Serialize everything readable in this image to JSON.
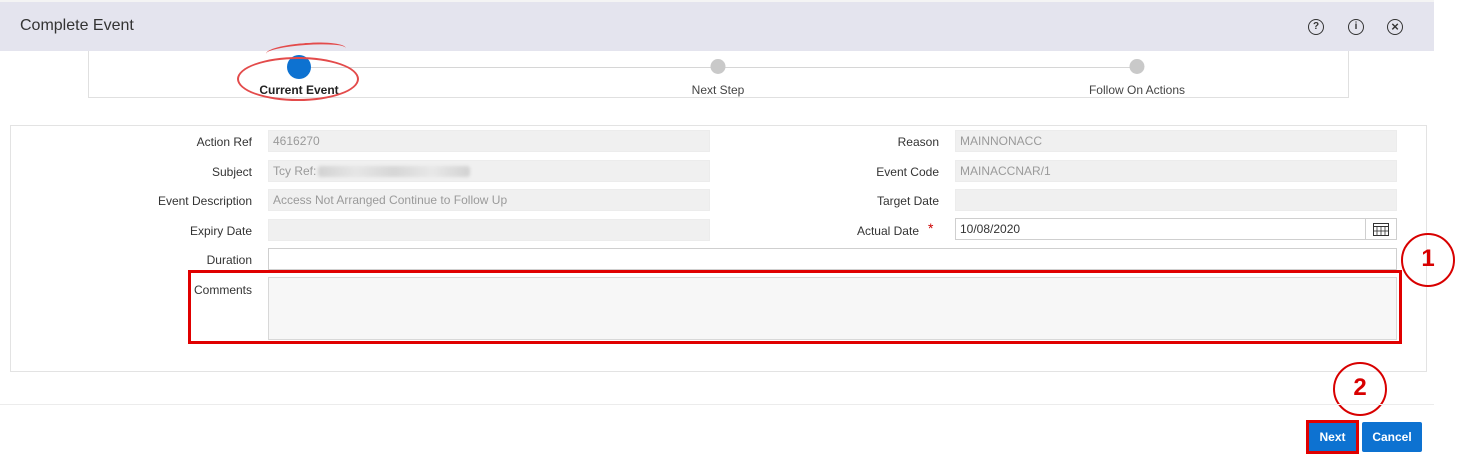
{
  "dialog": {
    "title": "Complete Event",
    "header_icons": [
      "help-icon",
      "info-icon",
      "close-icon"
    ],
    "help_glyph": "?",
    "info_glyph": "i",
    "close_glyph": "×"
  },
  "train": {
    "steps": [
      {
        "label": "Current Event",
        "current": true
      },
      {
        "label": "Next Step",
        "current": false
      },
      {
        "label": "Follow On Actions",
        "current": false
      }
    ]
  },
  "form": {
    "action_ref": {
      "label": "Action Ref",
      "value": "4616270"
    },
    "subject": {
      "label": "Subject",
      "value": "Tcy Ref:"
    },
    "event_description": {
      "label": "Event Description",
      "value": "Access Not Arranged Continue to Follow Up"
    },
    "expiry_date": {
      "label": "Expiry Date",
      "value": ""
    },
    "duration": {
      "label": "Duration",
      "value": ""
    },
    "comments": {
      "label": "Comments",
      "value": ""
    },
    "reason": {
      "label": "Reason",
      "value": "MAINNONACC"
    },
    "event_code": {
      "label": "Event Code",
      "value": "MAINACCNAR/1"
    },
    "target_date": {
      "label": "Target Date",
      "value": ""
    },
    "actual_date": {
      "label": "Actual Date",
      "value": "10/08/2020",
      "required_marker": "*"
    }
  },
  "annotations": {
    "marker_1": "1",
    "marker_2": "2"
  },
  "buttons": {
    "next": "Next",
    "cancel": "Cancel"
  },
  "colors": {
    "accent": "#0d72d1",
    "annotation_red": "#e00000",
    "header_bg": "#e4e4ee"
  }
}
